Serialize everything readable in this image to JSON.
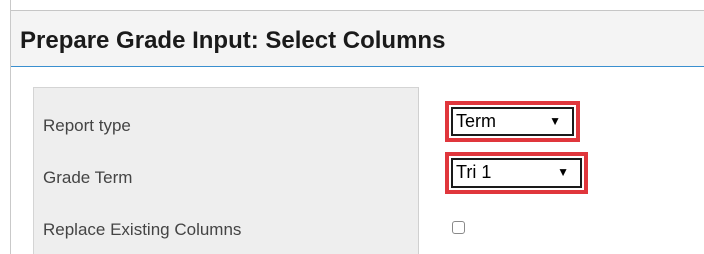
{
  "header": {
    "title": "Prepare Grade Input: Select Columns"
  },
  "form": {
    "report_type": {
      "label": "Report type",
      "value": "Term"
    },
    "grade_term": {
      "label": "Grade Term",
      "value": "Tri 1"
    },
    "replace_existing": {
      "label": "Replace Existing Columns",
      "checked": false
    }
  },
  "icons": {
    "dropdown_arrow": "▼"
  },
  "colors": {
    "highlight_border": "#e0363c",
    "header_underline": "#3a8fcf"
  }
}
